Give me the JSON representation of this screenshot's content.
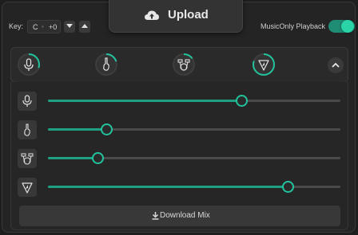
{
  "header": {
    "key_label": "Key:",
    "key_note": "C",
    "key_separator": "•",
    "key_offset": "+0",
    "upload_label": "Upload",
    "music_only_label": "MusicOnly Playback",
    "music_only_enabled": true
  },
  "tracks": [
    {
      "name": "vocals",
      "icon": "microphone-icon",
      "ring_fraction": 0.3
    },
    {
      "name": "guitar",
      "icon": "guitar-icon",
      "ring_fraction": 0.2
    },
    {
      "name": "drums",
      "icon": "drum-icon",
      "ring_fraction": 0.15
    },
    {
      "name": "bass",
      "icon": "bass-pick-icon",
      "ring_fraction": 0.8
    }
  ],
  "sliders": [
    {
      "name": "vocals",
      "value": 0.66
    },
    {
      "name": "guitar",
      "value": 0.2
    },
    {
      "name": "drums",
      "value": 0.17
    },
    {
      "name": "bass",
      "value": 0.82
    }
  ],
  "download_label": "Download Mix",
  "colors": {
    "accent": "#22c39c",
    "accent_dark": "#1f8c74",
    "background": "#242424"
  }
}
